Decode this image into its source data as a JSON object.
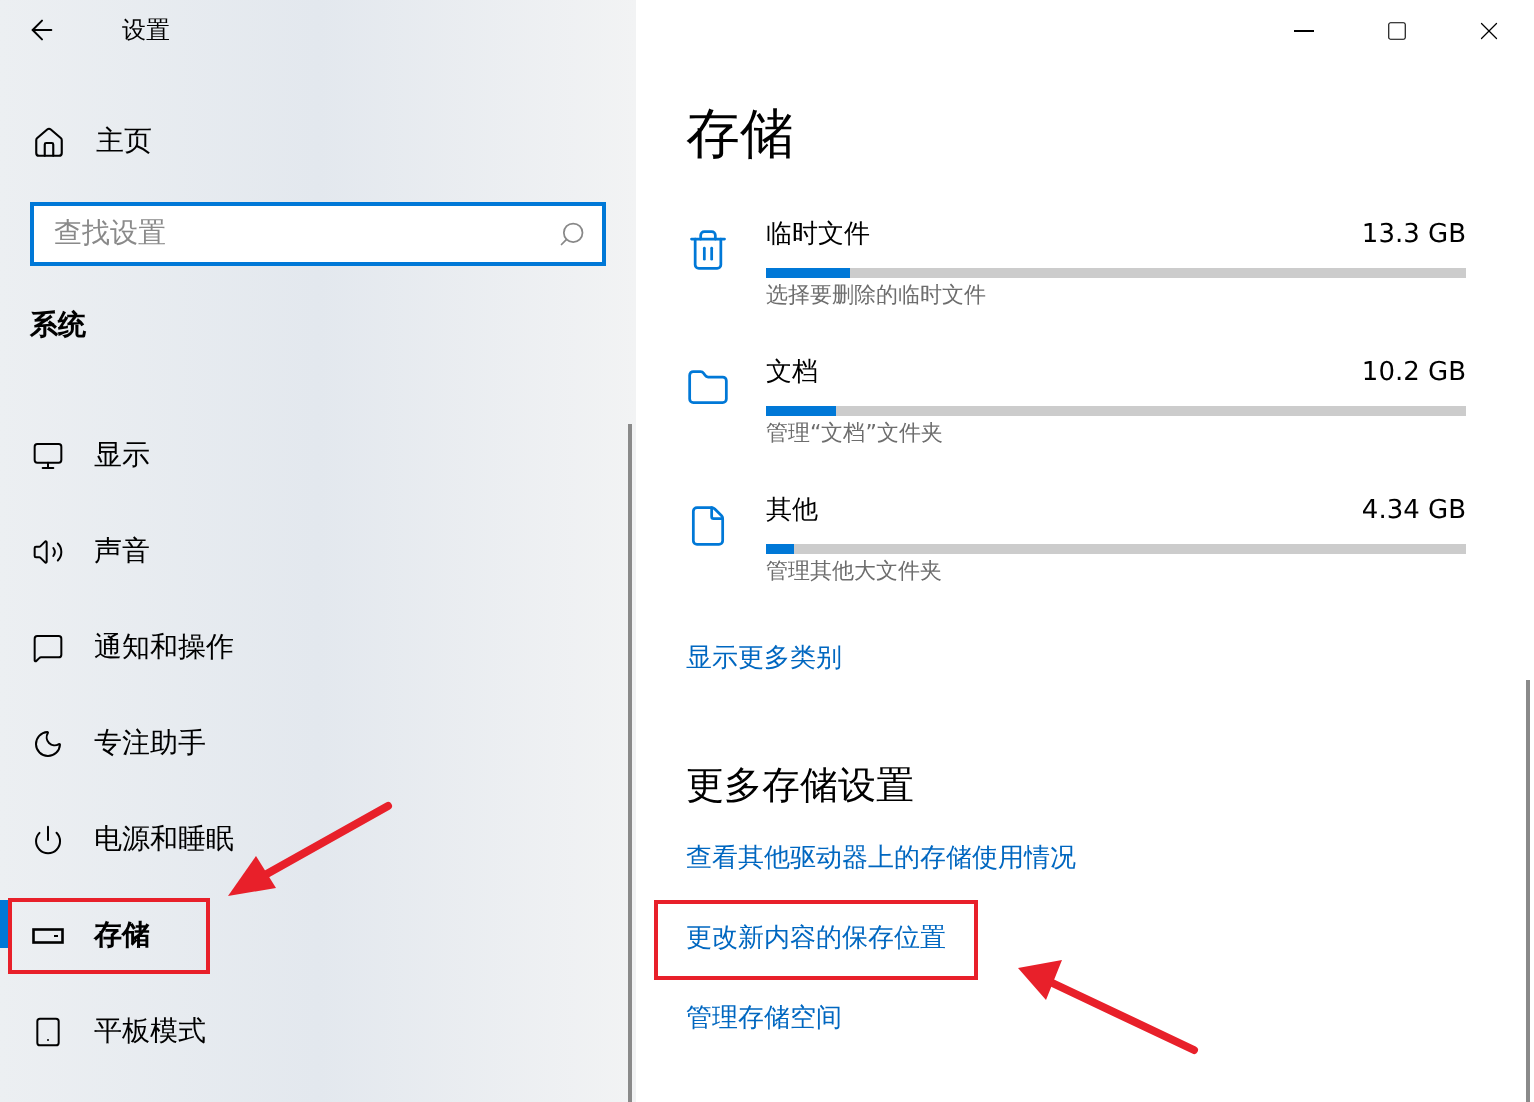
{
  "window": {
    "title": "设置"
  },
  "sidebar": {
    "home": "主页",
    "search": {
      "placeholder": "查找设置"
    },
    "section": "系统",
    "items": [
      {
        "label": "显示",
        "selected": false,
        "highlighted": false
      },
      {
        "label": "声音",
        "selected": false,
        "highlighted": false
      },
      {
        "label": "通知和操作",
        "selected": false,
        "highlighted": false
      },
      {
        "label": "专注助手",
        "selected": false,
        "highlighted": false
      },
      {
        "label": "电源和睡眠",
        "selected": false,
        "highlighted": false
      },
      {
        "label": "存储",
        "selected": true,
        "highlighted": true
      },
      {
        "label": "平板模式",
        "selected": false,
        "highlighted": false
      }
    ]
  },
  "content": {
    "title": "存储",
    "categories": [
      {
        "name": "临时文件",
        "size": "13.3 GB",
        "level": 0.12,
        "description": "选择要删除的临时文件"
      },
      {
        "name": "文档",
        "size": "10.2 GB",
        "level": 0.1,
        "description": "管理“文档”文件夹"
      },
      {
        "name": "其他",
        "size": "4.34 GB",
        "level": 0.04,
        "description": "管理其他大文件夹"
      }
    ],
    "more_link": "显示更多类别",
    "section_title": "更多存储设置",
    "links": [
      {
        "label": "查看其他驱动器上的存储使用情况",
        "highlighted": false
      },
      {
        "label": "更改新内容的保存位置",
        "highlighted": true
      },
      {
        "label": "管理存储空间",
        "highlighted": false
      }
    ]
  }
}
